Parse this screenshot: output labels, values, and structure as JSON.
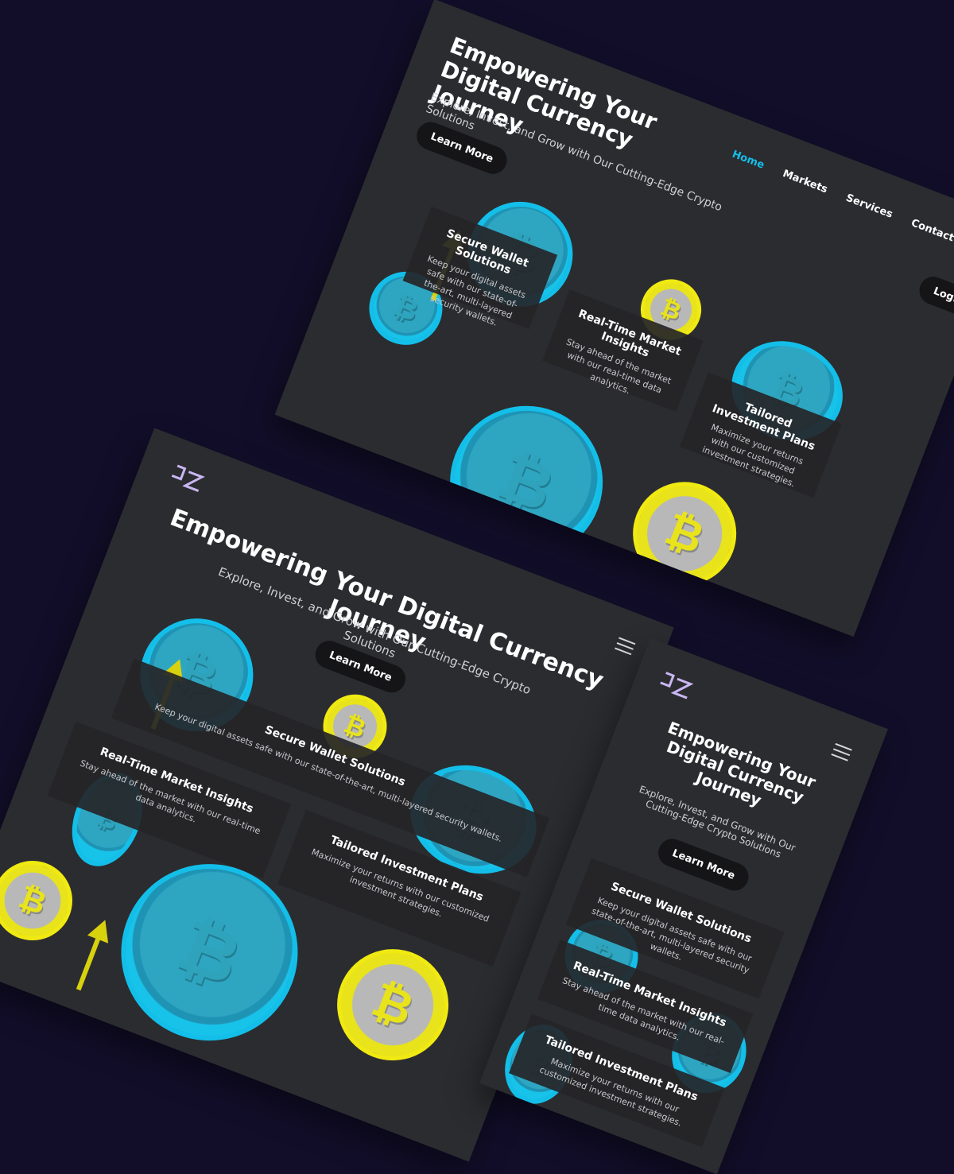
{
  "hero": {
    "title": "Empowering Your Digital Currency Journey",
    "title_mobile_line1": "Empowering Your",
    "title_mobile_line2": "Digital Currency",
    "title_mobile_line3": "Journey",
    "subtitle": "Explore, Invest, and Grow with Our Cutting-Edge Crypto Solutions",
    "cta_label": "Learn More"
  },
  "nav": {
    "items": [
      {
        "label": "Home",
        "active": true
      },
      {
        "label": "Markets",
        "active": false
      },
      {
        "label": "Services",
        "active": false
      },
      {
        "label": "Contact Us",
        "active": false
      }
    ],
    "login_label": "Login"
  },
  "features": [
    {
      "title": "Secure Wallet Solutions",
      "text": "Keep your digital assets safe with our state-of-the-art, multi-layered security wallets."
    },
    {
      "title": "Real-Time Market Insights",
      "text": "Stay ahead of the market with our real-time data analytics."
    },
    {
      "title": "Tailored Investment Plans",
      "text": "Maximize your returns with our customized investment strategies."
    }
  ],
  "brand": {
    "logo_icon": "jz-logo-icon",
    "accent": "#13bfe9",
    "coin_yellow": "#f0ea12",
    "background": "#2b2c30"
  },
  "icons": {
    "coin": "bitcoin-coin-icon",
    "arrow": "up-arrow-icon",
    "menu": "hamburger-menu-icon"
  }
}
